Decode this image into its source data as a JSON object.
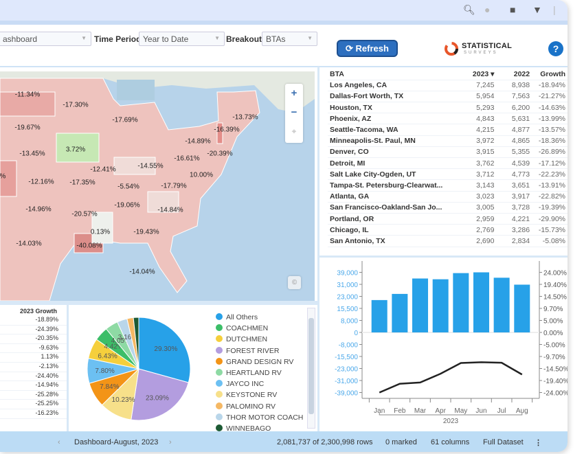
{
  "topbar": {
    "icons": [
      "search-icon",
      "comment-icon",
      "bookmark-icon",
      "filter-icon"
    ]
  },
  "toolbar": {
    "page_select": "ashboard",
    "time_period_label": "Time Period",
    "time_period": "Year to Date",
    "breakout_label": "Breakout",
    "breakout": "BTAs",
    "refresh_label": "Refresh",
    "logo_text": "STATISTICAL",
    "logo_sub": "SURVEYS",
    "help_label": "?"
  },
  "map": {
    "labels": [
      "-11.34%",
      "-17.30%",
      "-17.69%",
      "-13.73%",
      "-19.67%",
      "-16.39%",
      "-14.89%",
      "3.72%",
      "-13.45%",
      "-20.39%",
      "-16.61%",
      "-14.55%",
      "-12.41%",
      "10.00%",
      "-12.16%",
      "-17.35%",
      "-5.54%",
      "-17.79%",
      "-19.06%",
      "-14.96%",
      "-20.57%",
      "-14.84%",
      "0.13%",
      "-19.43%",
      "-14.03%",
      "-40.08%",
      "-14.04%",
      "%"
    ],
    "zoom_in": "+",
    "zoom_out": "−"
  },
  "bta_table": {
    "headers": [
      "BTA",
      "2023 ▾",
      "2022",
      "Growth"
    ],
    "rows": [
      [
        "Los Angeles, CA",
        "7,245",
        "8,938",
        "-18.94%"
      ],
      [
        "Dallas-Fort Worth, TX",
        "5,954",
        "7,563",
        "-21.27%"
      ],
      [
        "Houston, TX",
        "5,293",
        "6,200",
        "-14.63%"
      ],
      [
        "Phoenix, AZ",
        "4,843",
        "5,631",
        "-13.99%"
      ],
      [
        "Seattle-Tacoma, WA",
        "4,215",
        "4,877",
        "-13.57%"
      ],
      [
        "Minneapolis-St. Paul, MN",
        "3,972",
        "4,865",
        "-18.36%"
      ],
      [
        "Denver, CO",
        "3,915",
        "5,355",
        "-26.89%"
      ],
      [
        "Detroit, MI",
        "3,762",
        "4,539",
        "-17.12%"
      ],
      [
        "Salt Lake City-Ogden, UT",
        "3,712",
        "4,773",
        "-22.23%"
      ],
      [
        "Tampa-St. Petersburg-Clearwat...",
        "3,143",
        "3,651",
        "-13.91%"
      ],
      [
        "Atlanta, GA",
        "3,023",
        "3,917",
        "-22.82%"
      ],
      [
        "San Francisco-Oakland-San Jo...",
        "3,005",
        "3,728",
        "-19.39%"
      ],
      [
        "Portland, OR",
        "2,959",
        "4,221",
        "-29.90%"
      ],
      [
        "Chicago, IL",
        "2,769",
        "3,286",
        "-15.73%"
      ],
      [
        "San Antonio, TX",
        "2,690",
        "2,834",
        "-5.08%"
      ]
    ]
  },
  "growth_table": {
    "header": "2023 Growth",
    "values": [
      "-18.89%",
      "-24.39%",
      "-20.35%",
      "-9.63%",
      "1.13%",
      "-2.13%",
      "-24.40%",
      "-14.94%",
      "-25.28%",
      "-25.25%",
      "-16.23%"
    ]
  },
  "chart_data": [
    {
      "type": "pie",
      "slices": [
        {
          "name": "All Others",
          "value": 29.3,
          "label": "29.30%",
          "color": "#27a1e8"
        },
        {
          "name": "FOREST RIVER",
          "value": 23.09,
          "label": "23.09%",
          "color": "#b39ddf"
        },
        {
          "name": "KEYSTONE RV",
          "value": 10.23,
          "label": "10.23%",
          "color": "#f7e08a"
        },
        {
          "name": "GRAND DESIGN RV",
          "value": 7.84,
          "label": "7.84%",
          "color": "#f39417"
        },
        {
          "name": "JAYCO INC",
          "value": 7.8,
          "label": "7.80%",
          "color": "#6cc0f2"
        },
        {
          "name": "DUTCHMEN",
          "value": 6.43,
          "label": "6.43%",
          "color": "#f5cf3c"
        },
        {
          "name": "COACHMEN",
          "value": 4.42,
          "label": "4.42%",
          "color": "#3cbe68"
        },
        {
          "name": "HEARTLAND RV",
          "value": 4.05,
          "label": "4.05%",
          "color": "#8edaa4"
        },
        {
          "name": "THOR MOTOR COACH",
          "value": 3.16,
          "label": "3.16%",
          "color": "#b9d6ea"
        },
        {
          "name": "PALOMINO RV",
          "value": 2.0,
          "label": "",
          "color": "#f5b864"
        },
        {
          "name": "WINNEBAGO",
          "value": 1.68,
          "label": "",
          "color": "#1d5a34"
        }
      ],
      "legend": [
        "All Others",
        "COACHMEN",
        "DUTCHMEN",
        "FOREST RIVER",
        "GRAND DESIGN RV",
        "HEARTLAND RV",
        "JAYCO INC",
        "KEYSTONE RV",
        "PALOMINO RV",
        "THOR MOTOR COACH",
        "WINNEBAGO"
      ],
      "legend_placement": "right"
    },
    {
      "type": "bar+line",
      "categories": [
        "Jan",
        "Feb",
        "Mar",
        "Apr",
        "May",
        "Jun",
        "Jul",
        "Aug"
      ],
      "xlabel": "2023",
      "bars": {
        "values": [
          21000,
          25000,
          35000,
          34500,
          38500,
          39000,
          35500,
          31000
        ],
        "color": "#27a1e8"
      },
      "line": {
        "values": [
          -24.0,
          -20.5,
          -20.0,
          -16.5,
          -12.2,
          -11.9,
          -12.1,
          -16.8
        ],
        "color": "#222"
      },
      "left_ticks": [
        "39,000",
        "31,000",
        "23,000",
        "15,500",
        "8,000",
        "0",
        "-8,000",
        "-15,500",
        "-23,000",
        "-31,000",
        "-39,000"
      ],
      "right_ticks": [
        "24.00%",
        "19.40%",
        "14.50%",
        "9.70%",
        "5.00%",
        "0.00%",
        "-5.00%",
        "-9.70%",
        "-14.50%",
        "-19.40%",
        "-24.00%"
      ],
      "left_range": [
        -39000,
        39000
      ],
      "right_range": [
        -24,
        24
      ]
    }
  ],
  "status": {
    "page": "Dashboard-August, 2023",
    "rows": "2,081,737 of 2,300,998 rows",
    "marked": "0 marked",
    "columns": "61 columns",
    "dataset": "Full Dataset"
  }
}
